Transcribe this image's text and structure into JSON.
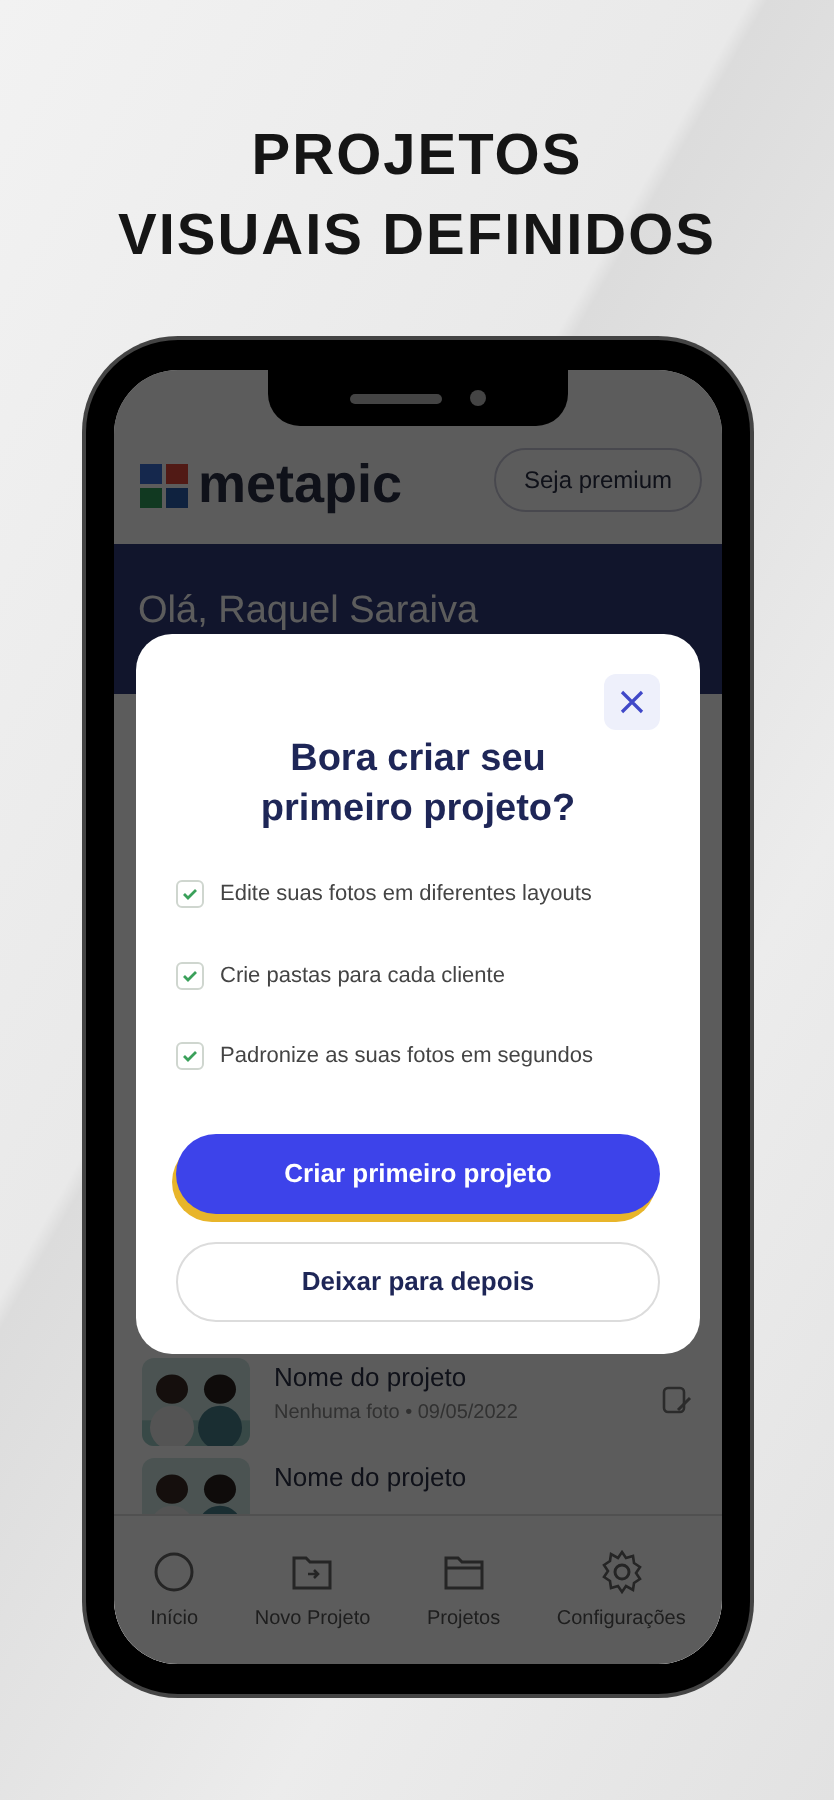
{
  "headline": [
    "PROJETOS",
    "VISUAIS DEFINIDOS"
  ],
  "app_header": {
    "logo": "metapic",
    "premium_button": "Seja premium"
  },
  "greeting": "Olá, Raquel Saraiva",
  "projects": [
    {
      "name": "Nome do projeto",
      "meta": "Nenhuma foto • 09/05/2022"
    },
    {
      "name": "Nome do projeto"
    }
  ],
  "bottom_nav": [
    {
      "label": "Início"
    },
    {
      "label": "Novo Projeto"
    },
    {
      "label": "Projetos"
    },
    {
      "label": "Configurações"
    }
  ],
  "modal": {
    "title": "Bora criar seu primeiro projeto?",
    "features": [
      {
        "text": "Edite suas fotos em diferentes layouts",
        "checked": true
      },
      {
        "text": "Crie pastas para cada cliente",
        "checked": true
      },
      {
        "text": "Padronize as suas fotos em segundos",
        "checked": true
      }
    ],
    "primary_button": "Criar primeiro projeto",
    "secondary_button": "Deixar para depois"
  }
}
